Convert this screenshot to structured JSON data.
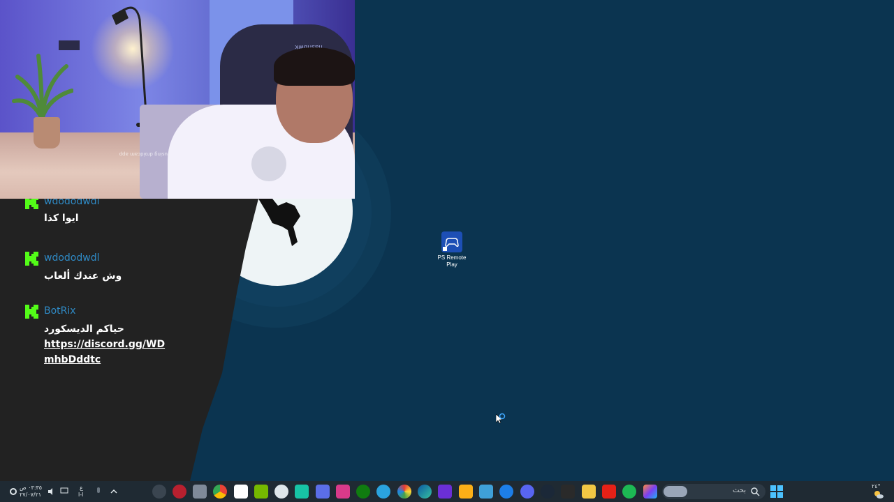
{
  "webcam": {
    "chair_brand": "flashbwk",
    "small_overlay": "using droidcam app"
  },
  "chat": {
    "messages": [
      {
        "username": "wdododwdl",
        "text": "ايوا كذا"
      },
      {
        "username": "wdododwdl",
        "text": "وش عندك ألعاب"
      },
      {
        "username": "BotRix",
        "text": "حياكم الديسكورد",
        "link_line1": "https://discord.gg/WD",
        "link_line2": "mhbDddtc"
      }
    ],
    "colors": {
      "username": "#2f8ac5",
      "badge": "#53fc18",
      "background": "#222222"
    }
  },
  "desktop": {
    "icons": [
      {
        "label_line1": "PS Remote",
        "label_line2": "Play",
        "icon": "ps-remote-play-icon"
      }
    ]
  },
  "taskbar": {
    "clock_time": "٠٣:٣٥ ص",
    "clock_date": "٢٧/٠٧/٢١",
    "lang_top": "ع",
    "lang_bottom": "ا-ا",
    "search_placeholder": "بحث",
    "weather_temp": "٢٤°",
    "apps": [
      "location-icon",
      "opera-gx-icon",
      "game-icon",
      "chrome-icon",
      "notion-icon",
      "nvidia-icon",
      "steam-deck-icon",
      "capcut-icon",
      "square-app-icon",
      "screen-recorder-icon",
      "xbox-icon",
      "telegram-icon",
      "color-picker-icon",
      "edge-icon",
      "nzxt-icon",
      "rockstar-icon",
      "display-icon",
      "remote-play-icon",
      "discord-icon",
      "steam-icon",
      "epic-games-icon",
      "file-explorer-icon",
      "youtube-icon",
      "spotify-icon",
      "copilot-icon"
    ]
  }
}
